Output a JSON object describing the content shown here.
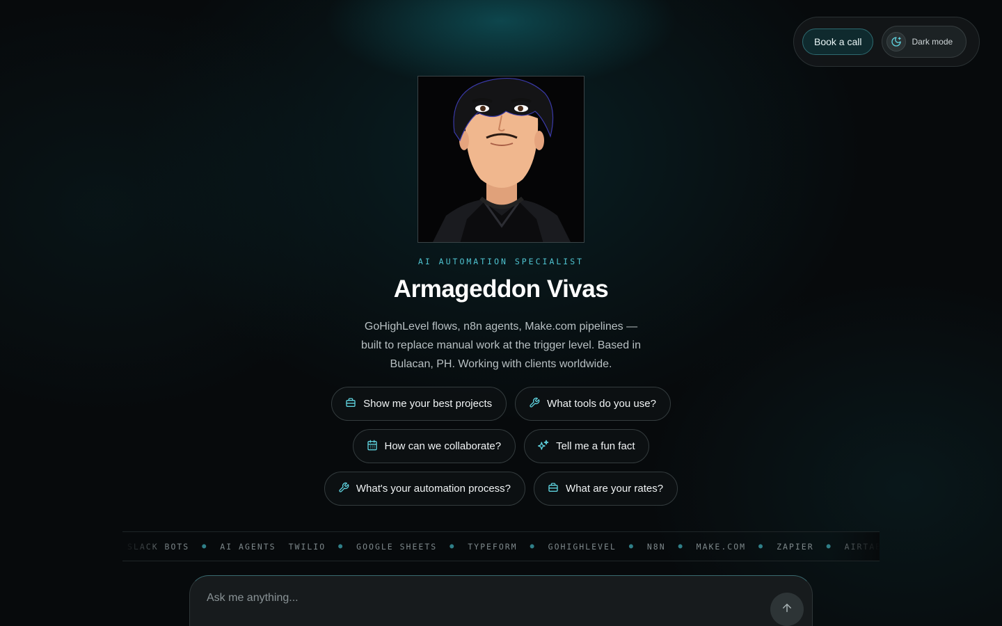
{
  "header": {
    "book_call_label": "Book a call",
    "dark_mode_label": "Dark mode"
  },
  "profile": {
    "eyebrow": "AI AUTOMATION SPECIALIST",
    "name": "Armageddon Vivas",
    "description": "GoHighLevel flows, n8n agents, Make.com pipelines — built to replace manual work at the trigger level. Based in Bulacan, PH. Working with clients worldwide."
  },
  "suggestions": [
    {
      "label": "Show me your best projects",
      "icon": "briefcase-icon"
    },
    {
      "label": "What tools do you use?",
      "icon": "wrench-icon"
    },
    {
      "label": "How can we collaborate?",
      "icon": "calendar-icon"
    },
    {
      "label": "Tell me a fun fact",
      "icon": "sparkles-icon"
    },
    {
      "label": "What's your automation process?",
      "icon": "wrench-icon"
    },
    {
      "label": "What are your rates?",
      "icon": "briefcase-icon"
    }
  ],
  "ticker": [
    "SLACK BOTS",
    "AI AGENTS",
    "TWILIO",
    "GOOGLE SHEETS",
    "TYPEFORM",
    "GOHIGHLEVEL",
    "N8N",
    "MAKE.COM",
    "ZAPIER",
    "AIRTABLE"
  ],
  "chat": {
    "placeholder": "Ask me anything..."
  },
  "colors": {
    "accent": "#4fc3d0",
    "background": "#070a0c"
  }
}
